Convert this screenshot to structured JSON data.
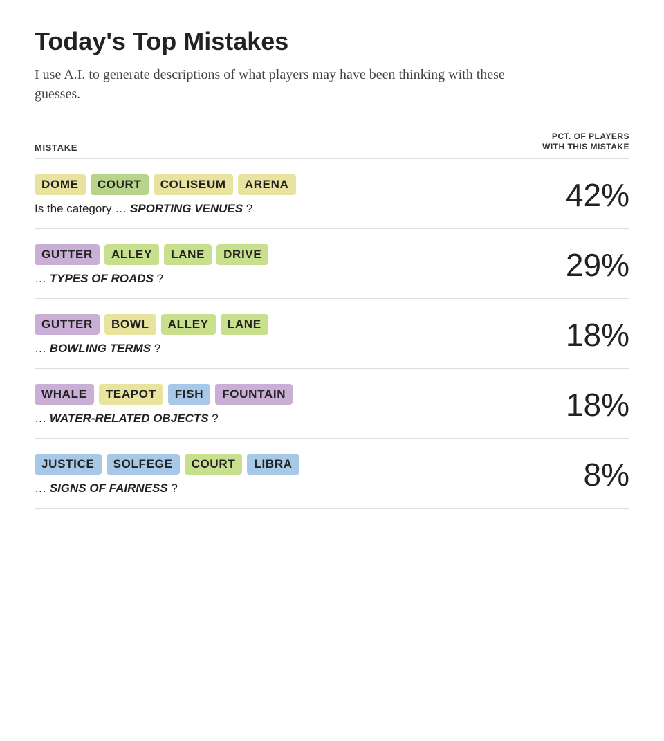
{
  "page": {
    "title": "Today's Top Mistakes",
    "subtitle": "I use A.I. to generate descriptions of what players may have been thinking with these guesses."
  },
  "table": {
    "col_mistake": "MISTAKE",
    "col_pct": "PCT. OF PLAYERS\nWITH THIS MISTAKE",
    "rows": [
      {
        "id": "row1",
        "pills": [
          {
            "word": "DOME",
            "color": "yellow"
          },
          {
            "word": "COURT",
            "color": "green"
          },
          {
            "word": "COLISEUM",
            "color": "yellow"
          },
          {
            "word": "ARENA",
            "color": "yellow"
          }
        ],
        "prefix": "Is the category …",
        "category": "SPORTING VENUES",
        "suffix": "?",
        "pct": "42%"
      },
      {
        "id": "row2",
        "pills": [
          {
            "word": "GUTTER",
            "color": "purple"
          },
          {
            "word": "ALLEY",
            "color": "light-green"
          },
          {
            "word": "LANE",
            "color": "light-green"
          },
          {
            "word": "DRIVE",
            "color": "light-green"
          }
        ],
        "prefix": "…",
        "category": "TYPES OF ROADS",
        "suffix": "?",
        "pct": "29%"
      },
      {
        "id": "row3",
        "pills": [
          {
            "word": "GUTTER",
            "color": "purple"
          },
          {
            "word": "BOWL",
            "color": "yellow"
          },
          {
            "word": "ALLEY",
            "color": "light-green"
          },
          {
            "word": "LANE",
            "color": "light-green"
          }
        ],
        "prefix": "…",
        "category": "BOWLING TERMS",
        "suffix": "?",
        "pct": "18%"
      },
      {
        "id": "row4",
        "pills": [
          {
            "word": "WHALE",
            "color": "purple"
          },
          {
            "word": "TEAPOT",
            "color": "yellow"
          },
          {
            "word": "FISH",
            "color": "blue"
          },
          {
            "word": "FOUNTAIN",
            "color": "purple"
          }
        ],
        "prefix": "…",
        "category": "WATER-RELATED OBJECTS",
        "suffix": "?",
        "pct": "18%"
      },
      {
        "id": "row5",
        "pills": [
          {
            "word": "JUSTICE",
            "color": "blue"
          },
          {
            "word": "SOLFEGE",
            "color": "blue"
          },
          {
            "word": "COURT",
            "color": "light-green"
          },
          {
            "word": "LIBRA",
            "color": "blue"
          }
        ],
        "prefix": "…",
        "category": "SIGNS OF FAIRNESS",
        "suffix": "?",
        "pct": "8%"
      }
    ]
  }
}
